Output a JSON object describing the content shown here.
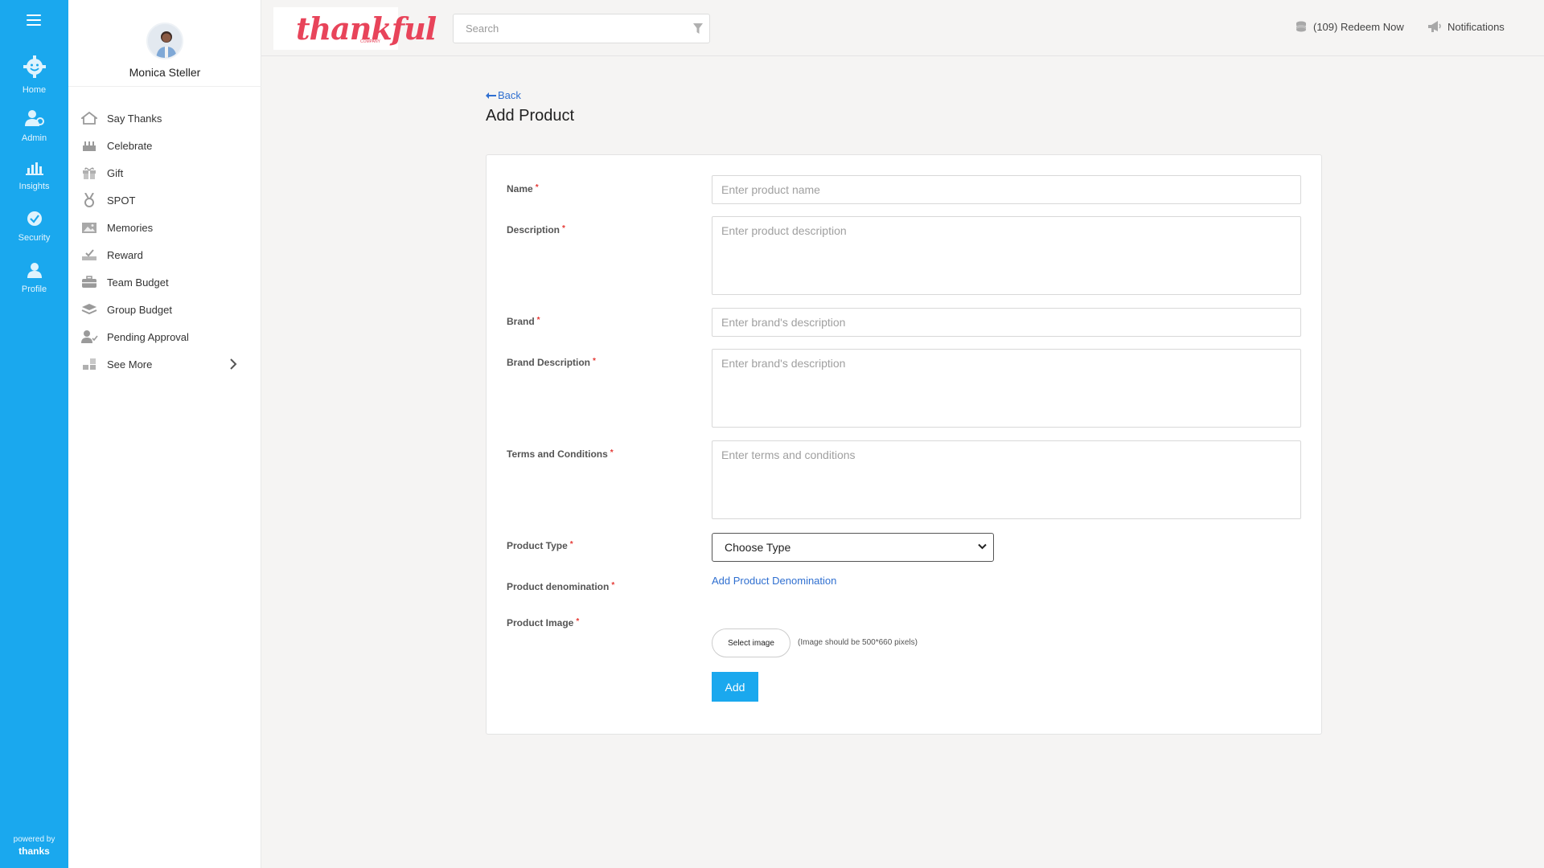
{
  "rail": {
    "items": [
      {
        "label": "Home",
        "icon": "home-icon"
      },
      {
        "label": "Admin",
        "icon": "admin-icon"
      },
      {
        "label": "Insights",
        "icon": "insights-icon"
      },
      {
        "label": "Security",
        "icon": "security-icon"
      },
      {
        "label": "Profile",
        "icon": "profile-icon"
      }
    ],
    "powered_by": "powered by",
    "powered_brand": "thanks"
  },
  "user": {
    "name": "Monica Steller"
  },
  "menu": [
    {
      "label": "Say Thanks",
      "icon": "say-thanks-icon"
    },
    {
      "label": "Celebrate",
      "icon": "celebrate-icon"
    },
    {
      "label": "Gift",
      "icon": "gift-icon"
    },
    {
      "label": "SPOT",
      "icon": "spot-medal-icon"
    },
    {
      "label": "Memories",
      "icon": "memories-icon"
    },
    {
      "label": "Reward",
      "icon": "reward-icon"
    },
    {
      "label": "Team Budget",
      "icon": "team-budget-icon"
    },
    {
      "label": "Group Budget",
      "icon": "group-budget-icon"
    },
    {
      "label": "Pending Approval",
      "icon": "pending-approval-icon"
    },
    {
      "label": "See More",
      "icon": "see-more-icon"
    }
  ],
  "header": {
    "logo_text": "thankful",
    "logo_sub": "COMPANY",
    "search_placeholder": "Search",
    "redeem_label": "(109) Redeem Now",
    "notifications_label": "Notifications"
  },
  "page": {
    "back_label": "Back",
    "title": "Add Product"
  },
  "form": {
    "required_mark": "*",
    "name": {
      "label": "Name",
      "placeholder": "Enter product name"
    },
    "description": {
      "label": "Description",
      "placeholder": "Enter product description"
    },
    "brand": {
      "label": "Brand",
      "placeholder": "Enter brand's description"
    },
    "brand_description": {
      "label": "Brand Description",
      "placeholder": "Enter brand's description"
    },
    "terms": {
      "label": "Terms and Conditions",
      "placeholder": "Enter terms and conditions"
    },
    "product_type": {
      "label": "Product Type",
      "value": "Choose Type"
    },
    "denomination": {
      "label": "Product denomination",
      "link": "Add Product Denomination"
    },
    "image": {
      "label": "Product Image",
      "button": "Select image",
      "hint": "(Image should be 500*660 pixels)"
    },
    "submit": "Add"
  },
  "colors": {
    "accent": "#1aa8ee",
    "link": "#2f6fd0",
    "logo": "#e8445a",
    "required": "#e53935"
  }
}
